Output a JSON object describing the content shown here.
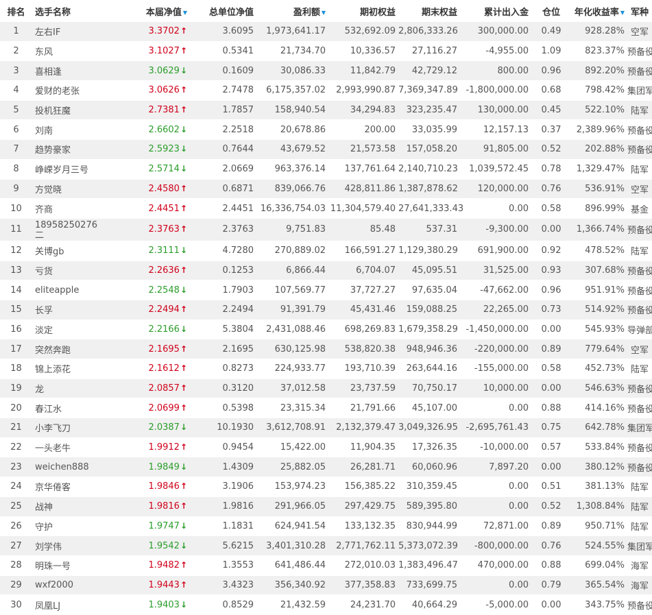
{
  "headers": {
    "rank": "排名",
    "name": "选手名称",
    "nav": "本届净值",
    "total_nav": "总单位净值",
    "profit": "盈利额",
    "start_equity": "期初权益",
    "end_equity": "期末权益",
    "flow": "累计出入金",
    "position": "仓位",
    "annual_return": "年化收益率",
    "army": "军种",
    "sort_glyph": "▼"
  },
  "colors": {
    "up": "#d0021b",
    "down": "#2a9d2a",
    "sort": "#1a8fd6"
  },
  "rows": [
    {
      "rank": "1",
      "name": "左右IF",
      "nav": "3.3702",
      "dir": "up",
      "total_nav": "3.6095",
      "profit": "1,973,641.17",
      "start_equity": "532,692.09",
      "end_equity": "2,806,333.26",
      "flow": "300,000.00",
      "position": "0.49",
      "annual_return": "928.28%",
      "army": "空军"
    },
    {
      "rank": "2",
      "name": "东风",
      "nav": "3.1027",
      "dir": "up",
      "total_nav": "0.5341",
      "profit": "21,734.70",
      "start_equity": "10,336.57",
      "end_equity": "27,116.27",
      "flow": "-4,955.00",
      "position": "1.09",
      "annual_return": "823.37%",
      "army": "预备役"
    },
    {
      "rank": "3",
      "name": "喜相逢",
      "nav": "3.0629",
      "dir": "down",
      "total_nav": "0.1609",
      "profit": "30,086.33",
      "start_equity": "11,842.79",
      "end_equity": "42,729.12",
      "flow": "800.00",
      "position": "0.96",
      "annual_return": "892.20%",
      "army": "预备役"
    },
    {
      "rank": "4",
      "name": "爱财的老张",
      "nav": "3.0626",
      "dir": "up",
      "total_nav": "2.7478",
      "profit": "6,175,357.02",
      "start_equity": "2,993,990.87",
      "end_equity": "7,369,347.89",
      "flow": "-1,800,000.00",
      "position": "0.68",
      "annual_return": "798.42%",
      "army": "集团军"
    },
    {
      "rank": "5",
      "name": "投机狂魔",
      "nav": "2.7381",
      "dir": "up",
      "total_nav": "1.7857",
      "profit": "158,940.54",
      "start_equity": "34,294.83",
      "end_equity": "323,235.47",
      "flow": "130,000.00",
      "position": "0.45",
      "annual_return": "522.10%",
      "army": "陆军"
    },
    {
      "rank": "6",
      "name": "刘南",
      "nav": "2.6602",
      "dir": "down",
      "total_nav": "2.2518",
      "profit": "20,678.86",
      "start_equity": "200.00",
      "end_equity": "33,035.99",
      "flow": "12,157.13",
      "position": "0.37",
      "annual_return": "2,389.96%",
      "army": "预备役"
    },
    {
      "rank": "7",
      "name": "趋势豪家",
      "nav": "2.5923",
      "dir": "down",
      "total_nav": "0.7644",
      "profit": "43,679.52",
      "start_equity": "21,573.58",
      "end_equity": "157,058.20",
      "flow": "91,805.00",
      "position": "0.52",
      "annual_return": "202.88%",
      "army": "预备役"
    },
    {
      "rank": "8",
      "name": "峥嵘岁月三号",
      "nav": "2.5714",
      "dir": "down",
      "total_nav": "2.0669",
      "profit": "963,376.14",
      "start_equity": "137,761.64",
      "end_equity": "2,140,710.23",
      "flow": "1,039,572.45",
      "position": "0.78",
      "annual_return": "1,329.47%",
      "army": "陆军"
    },
    {
      "rank": "9",
      "name": "方觉晓",
      "nav": "2.4580",
      "dir": "up",
      "total_nav": "0.6871",
      "profit": "839,066.76",
      "start_equity": "428,811.86",
      "end_equity": "1,387,878.62",
      "flow": "120,000.00",
      "position": "0.76",
      "annual_return": "536.91%",
      "army": "空军"
    },
    {
      "rank": "10",
      "name": "齐商",
      "nav": "2.4451",
      "dir": "up",
      "total_nav": "2.4451",
      "profit": "16,336,754.03",
      "start_equity": "11,304,579.40",
      "end_equity": "27,641,333.43",
      "flow": "0.00",
      "position": "0.58",
      "annual_return": "896.99%",
      "army": "基金"
    },
    {
      "rank": "11",
      "name": "18958250276二",
      "nav": "2.3763",
      "dir": "up",
      "total_nav": "2.3763",
      "profit": "9,751.83",
      "start_equity": "85.48",
      "end_equity": "537.31",
      "flow": "-9,300.00",
      "position": "0.00",
      "annual_return": "1,366.74%",
      "army": "预备役"
    },
    {
      "rank": "12",
      "name": "关博gb",
      "nav": "2.3111",
      "dir": "down",
      "total_nav": "4.7280",
      "profit": "270,889.02",
      "start_equity": "166,591.27",
      "end_equity": "1,129,380.29",
      "flow": "691,900.00",
      "position": "0.92",
      "annual_return": "478.52%",
      "army": "陆军"
    },
    {
      "rank": "13",
      "name": "亏货",
      "nav": "2.2636",
      "dir": "up",
      "total_nav": "0.1253",
      "profit": "6,866.44",
      "start_equity": "6,704.07",
      "end_equity": "45,095.51",
      "flow": "31,525.00",
      "position": "0.93",
      "annual_return": "307.68%",
      "army": "预备役"
    },
    {
      "rank": "14",
      "name": "eliteapple",
      "nav": "2.2548",
      "dir": "down",
      "total_nav": "1.7903",
      "profit": "107,569.77",
      "start_equity": "37,727.27",
      "end_equity": "97,635.04",
      "flow": "-47,662.00",
      "position": "0.96",
      "annual_return": "951.91%",
      "army": "预备役"
    },
    {
      "rank": "15",
      "name": "长孚",
      "nav": "2.2494",
      "dir": "up",
      "total_nav": "2.2494",
      "profit": "91,391.79",
      "start_equity": "45,431.46",
      "end_equity": "159,088.25",
      "flow": "22,265.00",
      "position": "0.73",
      "annual_return": "514.92%",
      "army": "预备役"
    },
    {
      "rank": "16",
      "name": "淡定",
      "nav": "2.2166",
      "dir": "down",
      "total_nav": "5.3804",
      "profit": "2,431,088.46",
      "start_equity": "698,269.83",
      "end_equity": "1,679,358.29",
      "flow": "-1,450,000.00",
      "position": "0.00",
      "annual_return": "545.93%",
      "army": "导弹部队"
    },
    {
      "rank": "17",
      "name": "突然奔跑",
      "nav": "2.1695",
      "dir": "up",
      "total_nav": "2.1695",
      "profit": "630,125.98",
      "start_equity": "538,820.38",
      "end_equity": "948,946.36",
      "flow": "-220,000.00",
      "position": "0.89",
      "annual_return": "779.64%",
      "army": "空军"
    },
    {
      "rank": "18",
      "name": "锦上添花",
      "nav": "2.1612",
      "dir": "up",
      "total_nav": "0.8273",
      "profit": "224,933.77",
      "start_equity": "193,710.39",
      "end_equity": "263,644.16",
      "flow": "-155,000.00",
      "position": "0.58",
      "annual_return": "452.73%",
      "army": "陆军"
    },
    {
      "rank": "19",
      "name": "龙",
      "nav": "2.0857",
      "dir": "up",
      "total_nav": "0.3120",
      "profit": "37,012.58",
      "start_equity": "23,737.59",
      "end_equity": "70,750.17",
      "flow": "10,000.00",
      "position": "0.00",
      "annual_return": "546.63%",
      "army": "预备役"
    },
    {
      "rank": "20",
      "name": "春江水",
      "nav": "2.0699",
      "dir": "up",
      "total_nav": "0.5398",
      "profit": "23,315.34",
      "start_equity": "21,791.66",
      "end_equity": "45,107.00",
      "flow": "0.00",
      "position": "0.88",
      "annual_return": "414.16%",
      "army": "预备役"
    },
    {
      "rank": "21",
      "name": "小李飞刀",
      "nav": "2.0387",
      "dir": "down",
      "total_nav": "10.1930",
      "profit": "3,612,708.91",
      "start_equity": "2,132,379.47",
      "end_equity": "3,049,326.95",
      "flow": "-2,695,761.43",
      "position": "0.75",
      "annual_return": "642.78%",
      "army": "集团军"
    },
    {
      "rank": "22",
      "name": "一头老牛",
      "nav": "1.9912",
      "dir": "up",
      "total_nav": "0.9454",
      "profit": "15,422.00",
      "start_equity": "11,904.35",
      "end_equity": "17,326.35",
      "flow": "-10,000.00",
      "position": "0.57",
      "annual_return": "533.84%",
      "army": "预备役"
    },
    {
      "rank": "23",
      "name": "weichen888",
      "nav": "1.9849",
      "dir": "down",
      "total_nav": "1.4309",
      "profit": "25,882.05",
      "start_equity": "26,281.71",
      "end_equity": "60,060.96",
      "flow": "7,897.20",
      "position": "0.00",
      "annual_return": "380.12%",
      "army": "预备役"
    },
    {
      "rank": "24",
      "name": "京华倦客",
      "nav": "1.9846",
      "dir": "up",
      "total_nav": "3.1906",
      "profit": "153,974.23",
      "start_equity": "156,385.22",
      "end_equity": "310,359.45",
      "flow": "0.00",
      "position": "0.51",
      "annual_return": "381.13%",
      "army": "陆军"
    },
    {
      "rank": "25",
      "name": "战神",
      "nav": "1.9816",
      "dir": "up",
      "total_nav": "1.9816",
      "profit": "291,966.05",
      "start_equity": "297,429.75",
      "end_equity": "589,395.80",
      "flow": "0.00",
      "position": "0.52",
      "annual_return": "1,308.84%",
      "army": "陆军"
    },
    {
      "rank": "26",
      "name": "守护",
      "nav": "1.9747",
      "dir": "down",
      "total_nav": "1.1831",
      "profit": "624,941.54",
      "start_equity": "133,132.35",
      "end_equity": "830,944.99",
      "flow": "72,871.00",
      "position": "0.89",
      "annual_return": "950.71%",
      "army": "陆军"
    },
    {
      "rank": "27",
      "name": "刘学伟",
      "nav": "1.9542",
      "dir": "down",
      "total_nav": "5.6215",
      "profit": "3,401,310.28",
      "start_equity": "2,771,762.11",
      "end_equity": "5,373,072.39",
      "flow": "-800,000.00",
      "position": "0.76",
      "annual_return": "524.55%",
      "army": "集团军"
    },
    {
      "rank": "28",
      "name": "明珠一号",
      "nav": "1.9482",
      "dir": "up",
      "total_nav": "1.3553",
      "profit": "641,486.44",
      "start_equity": "272,010.03",
      "end_equity": "1,383,496.47",
      "flow": "470,000.00",
      "position": "0.88",
      "annual_return": "699.04%",
      "army": "海军"
    },
    {
      "rank": "29",
      "name": "wxf2000",
      "nav": "1.9443",
      "dir": "up",
      "total_nav": "3.4323",
      "profit": "356,340.92",
      "start_equity": "377,358.83",
      "end_equity": "733,699.75",
      "flow": "0.00",
      "position": "0.79",
      "annual_return": "365.54%",
      "army": "海军"
    },
    {
      "rank": "30",
      "name": "凤凰LJ",
      "nav": "1.9403",
      "dir": "down",
      "total_nav": "0.8529",
      "profit": "21,432.59",
      "start_equity": "24,231.70",
      "end_equity": "40,664.29",
      "flow": "-5,000.00",
      "position": "0.00",
      "annual_return": "343.75%",
      "army": "预备役"
    }
  ]
}
